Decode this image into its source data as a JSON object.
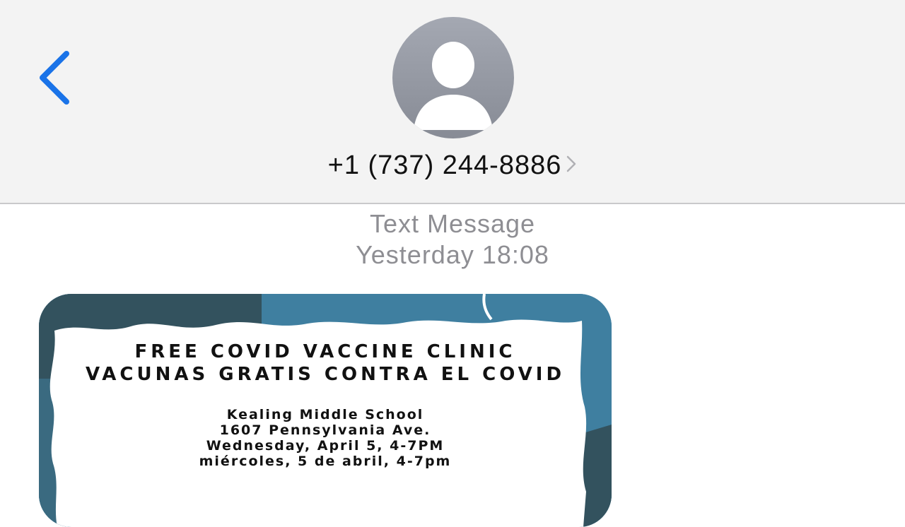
{
  "header": {
    "back_icon": "chevron-left-icon",
    "avatar_icon": "person-placeholder-icon",
    "contact_number": "+1 (737) 244-8886",
    "detail_icon": "chevron-right-icon"
  },
  "thread": {
    "message_kind": "Text Message",
    "timestamp": "Yesterday 18:08"
  },
  "message": {
    "flyer": {
      "headline_en": "FREE COVID VACCINE CLINIC",
      "headline_es": "VACUNAS GRATIS CONTRA EL COVID",
      "location": "Kealing Middle School",
      "address": "1607 Pennsylvania Ave.",
      "date_en": "Wednesday, April 5, 4-7PM",
      "date_es": "miércoles, 5 de abril, 4-7pm"
    }
  },
  "colors": {
    "accent_blue": "#1a73e8",
    "header_bg": "#f3f3f3",
    "meta_gray": "#8e8e93",
    "flyer_blue": "#3f7fa0",
    "flyer_dark": "#33525e"
  }
}
